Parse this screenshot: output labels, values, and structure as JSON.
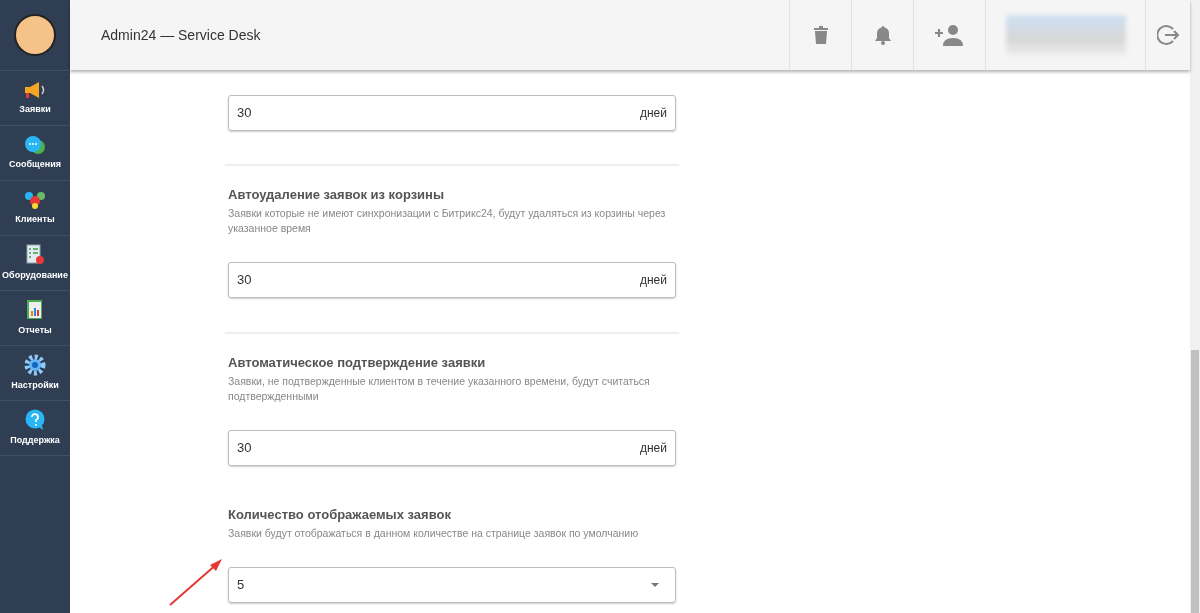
{
  "header": {
    "title": "Admin24 — Service Desk"
  },
  "sidebar": {
    "items": [
      {
        "label": "Заявки"
      },
      {
        "label": "Сообщения"
      },
      {
        "label": "Клиенты"
      },
      {
        "label": "Оборудование"
      },
      {
        "label": "Отчеты"
      },
      {
        "label": "Настройки"
      },
      {
        "label": "Поддержка"
      }
    ]
  },
  "sections": [
    {
      "kind": "input",
      "divider_before": false,
      "value": "30",
      "unit": "дней"
    },
    {
      "kind": "input",
      "divider_before": true,
      "title": "Автоудаление заявок из корзины",
      "description": "Заявки которые не имеют синхронизации с Битрикс24, будут удаляться из корзины через указанное время",
      "value": "30",
      "unit": "дней"
    },
    {
      "kind": "input",
      "divider_before": true,
      "title": "Автоматическое подтверждение заявки",
      "description": "Заявки, не подтвержденные клиентом в течение указанного времени, будут считаться подтвержденными",
      "value": "30",
      "unit": "дней"
    },
    {
      "kind": "select",
      "divider_before": false,
      "title": "Количество отображаемых заявок",
      "description": "Заявки будут отображаться в данном количестве на странице заявок по умолчанию",
      "value": "5"
    }
  ]
}
